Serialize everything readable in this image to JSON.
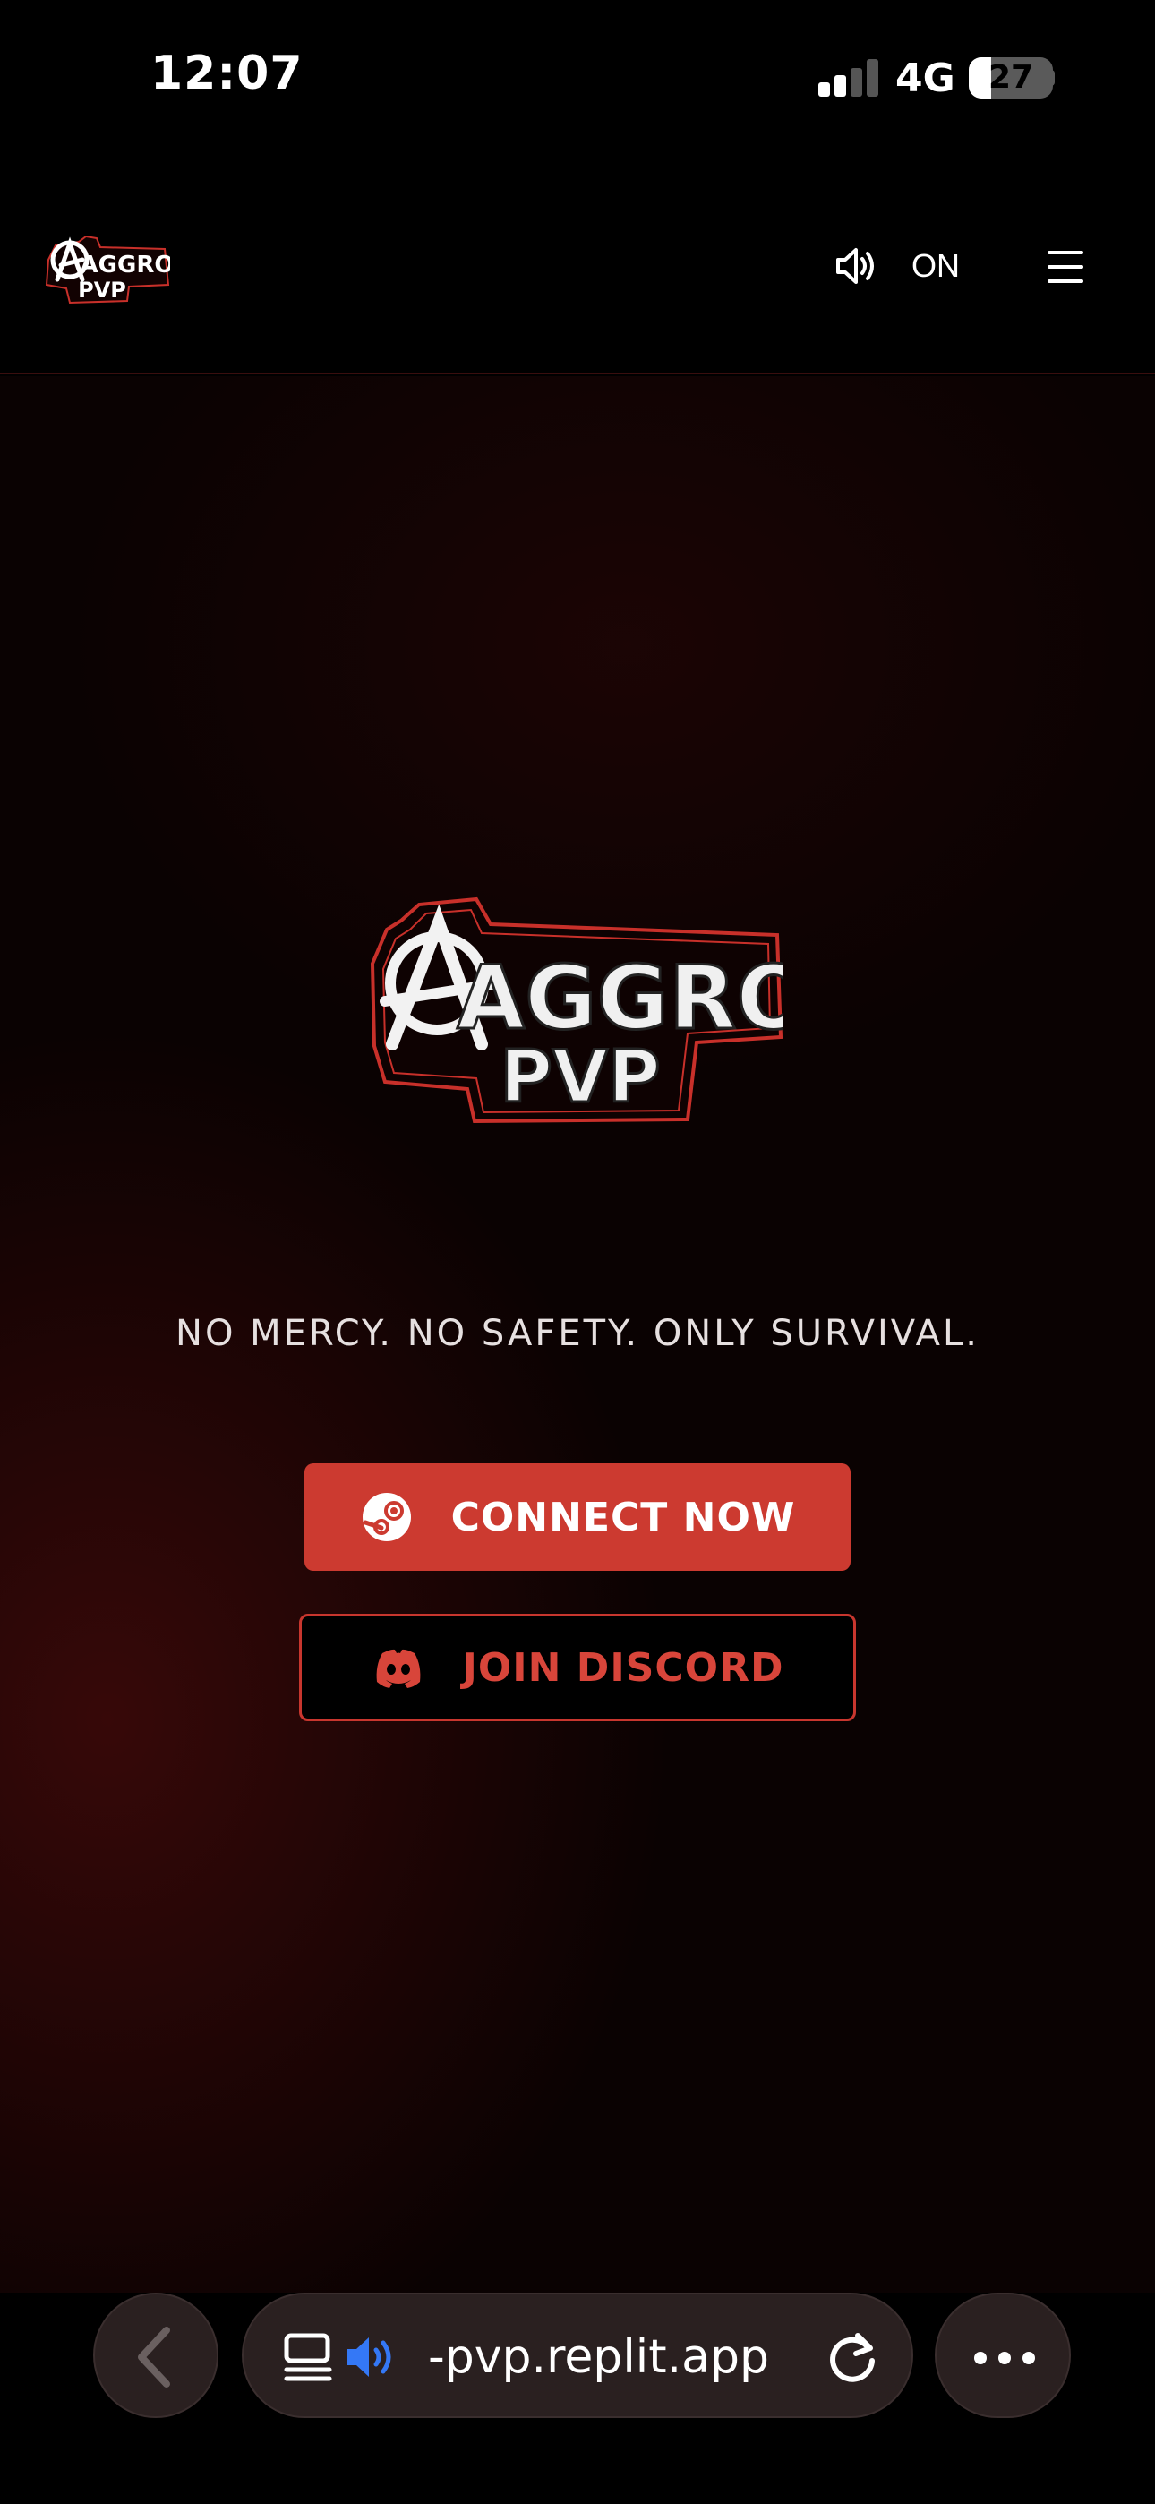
{
  "status_bar": {
    "time": "12:07",
    "network": "4G",
    "battery": "27",
    "battery_level": 0.27
  },
  "header": {
    "logo_text_line1": "AGGRO",
    "logo_text_line2": "PVP",
    "sound_icon": "speaker-icon",
    "sound_label": "ON",
    "menu_icon": "hamburger-menu-icon"
  },
  "hero": {
    "logo_text_line1": "AGGRO",
    "logo_text_line2": "PVP",
    "tagline": "NO MERCY. NO SAFETY. ONLY SURVIVAL.",
    "connect_label": "CONNECT NOW",
    "connect_icon": "steam-icon",
    "discord_label": "JOIN DISCORD",
    "discord_icon": "discord-icon"
  },
  "browser": {
    "back_icon": "chevron-left-icon",
    "tab_icon": "tab-overview-icon",
    "audio_icon": "speaker-playing-icon",
    "url": "-pvp.replit.app",
    "reload_icon": "reload-icon",
    "more_icon": "more-icon"
  },
  "colors": {
    "accent": "#cc3a30",
    "discord_red": "#d8453a",
    "background": "#0a0202",
    "audio_blue": "#3478f6"
  }
}
